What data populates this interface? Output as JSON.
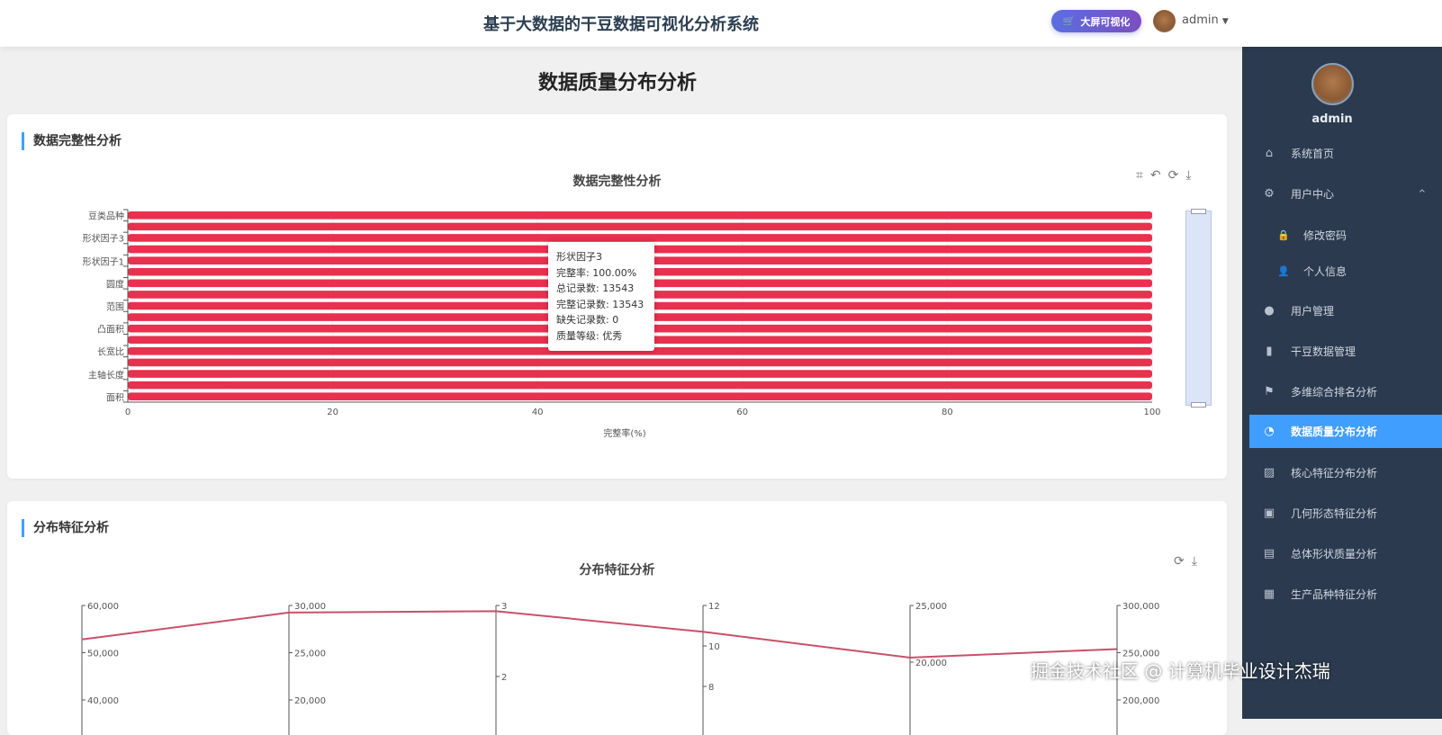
{
  "header": {
    "title": "基于大数据的干豆数据可视化分析系统",
    "bigscreen_label": "大屏可视化",
    "user": "admin"
  },
  "sidebar": {
    "user": "admin",
    "items": [
      {
        "label": "系统首页",
        "icon": "⌂"
      },
      {
        "label": "用户中心",
        "icon": "⚙",
        "chevron": "^"
      },
      {
        "label": "修改密码",
        "icon": "🔒",
        "sub": true
      },
      {
        "label": "个人信息",
        "icon": "👤",
        "sub": true
      },
      {
        "label": "用户管理",
        "icon": "●"
      },
      {
        "label": "干豆数据管理",
        "icon": "▮"
      },
      {
        "label": "多维综合排名分析",
        "icon": "⚑"
      },
      {
        "label": "数据质量分布分析",
        "icon": "◔",
        "active": true
      },
      {
        "label": "核心特征分布分析",
        "icon": "▨"
      },
      {
        "label": "几何形态特征分析",
        "icon": "▣"
      },
      {
        "label": "总体形状质量分析",
        "icon": "▤"
      },
      {
        "label": "生产品种特征分析",
        "icon": "▦"
      }
    ]
  },
  "page_title": "数据质量分布分析",
  "card1": {
    "title": "数据完整性分析"
  },
  "card2": {
    "title": "分布特征分析"
  },
  "tooltip": {
    "name": "形状因子3",
    "lines": [
      "完整率: 100.00%",
      "总记录数: 13543",
      "完整记录数: 13543",
      "缺失记录数: 0",
      "质量等级: 优秀"
    ]
  },
  "watermark": "掘金技术社区 @ 计算机毕业设计杰瑞",
  "colors": {
    "bar": "#e8304f",
    "accent": "#409eff",
    "sidebar": "#2b3a4f",
    "line": "#c8506a"
  },
  "chart_data": [
    {
      "type": "bar",
      "orientation": "horizontal",
      "title": "数据完整性分析",
      "xlabel": "完整率(%)",
      "xlim": [
        0,
        100
      ],
      "xticks": [
        0,
        20,
        40,
        60,
        80,
        100
      ],
      "visible_category_labels": [
        "面积",
        "主轴长度",
        "长宽比",
        "凸面积",
        "范围",
        "圆度",
        "形状因子1",
        "形状因子3",
        "豆类品种"
      ],
      "values": [
        100,
        100,
        100,
        100,
        100,
        100,
        100,
        100,
        100,
        100,
        100,
        100,
        100,
        100,
        100,
        100,
        100
      ]
    },
    {
      "type": "line",
      "subtype": "parallel",
      "title": "分布特征分析",
      "axes": [
        {
          "ticks": [
            "60,000",
            "50,000",
            "40,000"
          ],
          "range": [
            40000,
            60000
          ],
          "value": 52800
        },
        {
          "ticks": [
            "30,000",
            "25,000",
            "20,000"
          ],
          "range": [
            20000,
            30000
          ],
          "value": 29250
        },
        {
          "ticks": [
            "3",
            "2"
          ],
          "range": [
            2,
            3
          ],
          "value": 2.92
        },
        {
          "ticks": [
            "12",
            "10",
            "8"
          ],
          "range": [
            8,
            12
          ],
          "value": 10.7
        },
        {
          "ticks": [
            "25,000",
            "20,000"
          ],
          "range": [
            20000,
            25000
          ],
          "value": 20400
        },
        {
          "ticks": [
            "300,000",
            "250,000",
            "200,000"
          ],
          "range": [
            200000,
            300000
          ],
          "value": 253800
        }
      ]
    }
  ]
}
